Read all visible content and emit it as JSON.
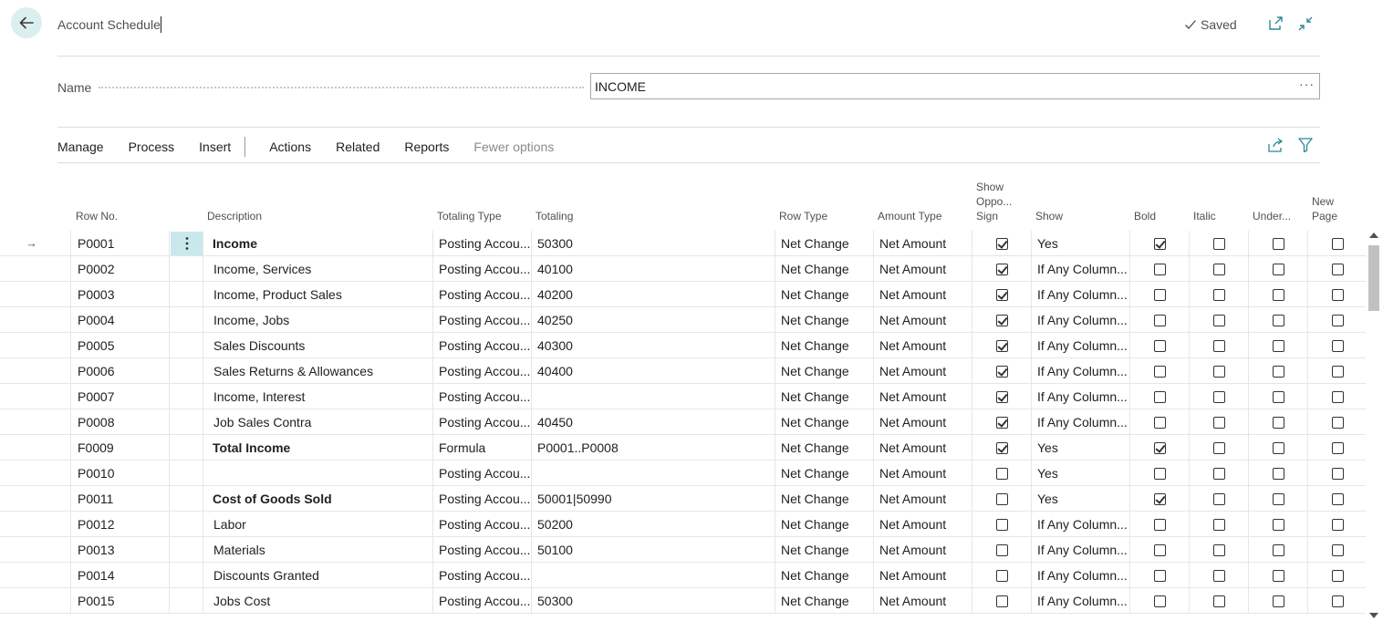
{
  "header": {
    "title": "Account Schedule",
    "saved_label": "Saved"
  },
  "fields": {
    "name_label": "Name",
    "name_value": "INCOME",
    "more_label": "···"
  },
  "actions": {
    "primary": [
      "Manage",
      "Process",
      "Insert"
    ],
    "secondary": [
      "Actions",
      "Related",
      "Reports"
    ],
    "fewer_options": "Fewer options"
  },
  "columns": {
    "row_no": "Row No.",
    "description": "Description",
    "totaling_type": "Totaling Type",
    "totaling": "Totaling",
    "row_type": "Row Type",
    "amount_type": "Amount Type",
    "show_opposite_sign": [
      "Show",
      "Oppo...",
      "Sign"
    ],
    "show": "Show",
    "bold": "Bold",
    "italic": "Italic",
    "underline": "Under...",
    "new_page": [
      "New",
      "Page"
    ]
  },
  "rows": [
    {
      "row_no": "P0001",
      "description": "Income",
      "desc_bold": true,
      "desc_indent": false,
      "totaling_type": "Posting Accou...",
      "totaling": "50300",
      "row_type": "Net Change",
      "amount_type": "Net Amount",
      "opp_sign": true,
      "show": "Yes",
      "bold": true,
      "italic": false,
      "underline": false,
      "new_page": false
    },
    {
      "row_no": "P0002",
      "description": "Income, Services",
      "desc_bold": false,
      "desc_indent": true,
      "totaling_type": "Posting Accou...",
      "totaling": "40100",
      "row_type": "Net Change",
      "amount_type": "Net Amount",
      "opp_sign": true,
      "show": "If Any Column...",
      "bold": false,
      "italic": false,
      "underline": false,
      "new_page": false
    },
    {
      "row_no": "P0003",
      "description": "Income, Product Sales",
      "desc_bold": false,
      "desc_indent": true,
      "totaling_type": "Posting Accou...",
      "totaling": "40200",
      "row_type": "Net Change",
      "amount_type": "Net Amount",
      "opp_sign": true,
      "show": "If Any Column...",
      "bold": false,
      "italic": false,
      "underline": false,
      "new_page": false
    },
    {
      "row_no": "P0004",
      "description": "Income, Jobs",
      "desc_bold": false,
      "desc_indent": true,
      "totaling_type": "Posting Accou...",
      "totaling": "40250",
      "row_type": "Net Change",
      "amount_type": "Net Amount",
      "opp_sign": true,
      "show": "If Any Column...",
      "bold": false,
      "italic": false,
      "underline": false,
      "new_page": false
    },
    {
      "row_no": "P0005",
      "description": "Sales Discounts",
      "desc_bold": false,
      "desc_indent": true,
      "totaling_type": "Posting Accou...",
      "totaling": "40300",
      "row_type": "Net Change",
      "amount_type": "Net Amount",
      "opp_sign": true,
      "show": "If Any Column...",
      "bold": false,
      "italic": false,
      "underline": false,
      "new_page": false
    },
    {
      "row_no": "P0006",
      "description": "Sales Returns & Allowances",
      "desc_bold": false,
      "desc_indent": true,
      "totaling_type": "Posting Accou...",
      "totaling": "40400",
      "row_type": "Net Change",
      "amount_type": "Net Amount",
      "opp_sign": true,
      "show": "If Any Column...",
      "bold": false,
      "italic": false,
      "underline": false,
      "new_page": false
    },
    {
      "row_no": "P0007",
      "description": "Income, Interest",
      "desc_bold": false,
      "desc_indent": true,
      "totaling_type": "Posting Accou...",
      "totaling": "",
      "row_type": "Net Change",
      "amount_type": "Net Amount",
      "opp_sign": true,
      "show": "If Any Column...",
      "bold": false,
      "italic": false,
      "underline": false,
      "new_page": false
    },
    {
      "row_no": "P0008",
      "description": "Job Sales Contra",
      "desc_bold": false,
      "desc_indent": true,
      "totaling_type": "Posting Accou...",
      "totaling": "40450",
      "row_type": "Net Change",
      "amount_type": "Net Amount",
      "opp_sign": true,
      "show": "If Any Column...",
      "bold": false,
      "italic": false,
      "underline": false,
      "new_page": false
    },
    {
      "row_no": "F0009",
      "description": "Total Income",
      "desc_bold": true,
      "desc_indent": false,
      "totaling_type": "Formula",
      "totaling": "P0001..P0008",
      "row_type": "Net Change",
      "amount_type": "Net Amount",
      "opp_sign": true,
      "show": "Yes",
      "bold": true,
      "italic": false,
      "underline": false,
      "new_page": false
    },
    {
      "row_no": "P0010",
      "description": "",
      "desc_bold": false,
      "desc_indent": false,
      "totaling_type": "Posting Accou...",
      "totaling": "",
      "row_type": "Net Change",
      "amount_type": "Net Amount",
      "opp_sign": false,
      "show": "Yes",
      "bold": false,
      "italic": false,
      "underline": false,
      "new_page": false
    },
    {
      "row_no": "P0011",
      "description": "Cost of Goods Sold",
      "desc_bold": true,
      "desc_indent": false,
      "totaling_type": "Posting Accou...",
      "totaling": "50001|50990",
      "row_type": "Net Change",
      "amount_type": "Net Amount",
      "opp_sign": false,
      "show": "Yes",
      "bold": true,
      "italic": false,
      "underline": false,
      "new_page": false
    },
    {
      "row_no": "P0012",
      "description": "Labor",
      "desc_bold": false,
      "desc_indent": true,
      "totaling_type": "Posting Accou...",
      "totaling": "50200",
      "row_type": "Net Change",
      "amount_type": "Net Amount",
      "opp_sign": false,
      "show": "If Any Column...",
      "bold": false,
      "italic": false,
      "underline": false,
      "new_page": false
    },
    {
      "row_no": "P0013",
      "description": "Materials",
      "desc_bold": false,
      "desc_indent": true,
      "totaling_type": "Posting Accou...",
      "totaling": "50100",
      "row_type": "Net Change",
      "amount_type": "Net Amount",
      "opp_sign": false,
      "show": "If Any Column...",
      "bold": false,
      "italic": false,
      "underline": false,
      "new_page": false
    },
    {
      "row_no": "P0014",
      "description": "Discounts Granted",
      "desc_bold": false,
      "desc_indent": true,
      "totaling_type": "Posting Accou...",
      "totaling": "",
      "row_type": "Net Change",
      "amount_type": "Net Amount",
      "opp_sign": false,
      "show": "If Any Column...",
      "bold": false,
      "italic": false,
      "underline": false,
      "new_page": false
    },
    {
      "row_no": "P0015",
      "description": "Jobs Cost",
      "desc_bold": false,
      "desc_indent": true,
      "totaling_type": "Posting Accou...",
      "totaling": "50300",
      "row_type": "Net Change",
      "amount_type": "Net Amount",
      "opp_sign": false,
      "show": "If Any Column...",
      "bold": false,
      "italic": false,
      "underline": false,
      "new_page": false
    }
  ],
  "icons": {
    "back": "arrow-left-icon",
    "saved": "checkmark-icon",
    "open_new": "open-in-new-window-icon",
    "collapse": "collapse-icon",
    "share": "share-icon",
    "filter": "filter-icon",
    "row_menu": "vertical-ellipsis-icon",
    "current_row": "arrow-right-icon"
  },
  "colors": {
    "accent": "#00838f",
    "back_button_bg": "#dbeef0",
    "row_menu_bg": "#c9e8ec"
  }
}
